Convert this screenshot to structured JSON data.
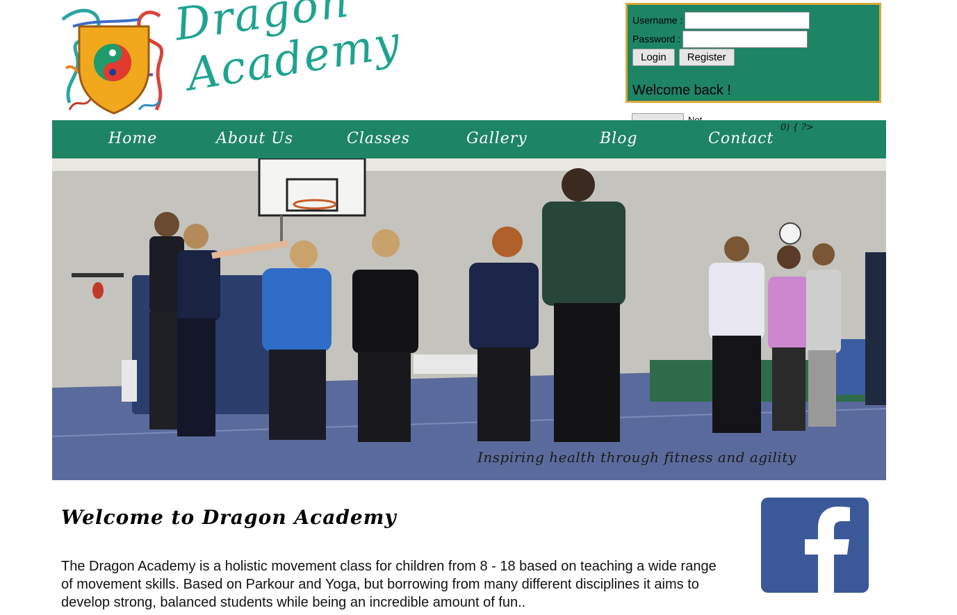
{
  "brand": {
    "logo_line1": "Dragon",
    "logo_line2": "Academy",
    "colors": {
      "accent_green": "#1d8464",
      "logo_teal": "#1fa390",
      "login_border_gold": "#d9a73a",
      "facebook_blue": "#3b5998"
    }
  },
  "login": {
    "username_label": "Username :",
    "username_value": "",
    "password_label": "Password :",
    "password_value": "",
    "login_button": "Login",
    "register_button": "Register",
    "welcome_message": "Welcome back !"
  },
  "nav": {
    "items": [
      {
        "label": "Home"
      },
      {
        "label": "About Us"
      },
      {
        "label": "Classes"
      },
      {
        "label": "Gallery"
      },
      {
        "label": "Blog"
      },
      {
        "label": "Contact"
      }
    ],
    "stray_code": "0) { ?>"
  },
  "hero": {
    "tagline": "Inspiring health through fitness and agility"
  },
  "content": {
    "heading": "Welcome to Dragon Academy",
    "intro": "The Dragon Academy is a holistic movement class for children from 8 - 18 based on teaching a wide range of movement skills. Based on Parkour and Yoga, but borrowing from many different disciplines it aims to develop strong, balanced students while being an incredible amount of fun.."
  },
  "social": {
    "facebook_icon": "facebook-icon",
    "facebook_glyph": "f"
  }
}
